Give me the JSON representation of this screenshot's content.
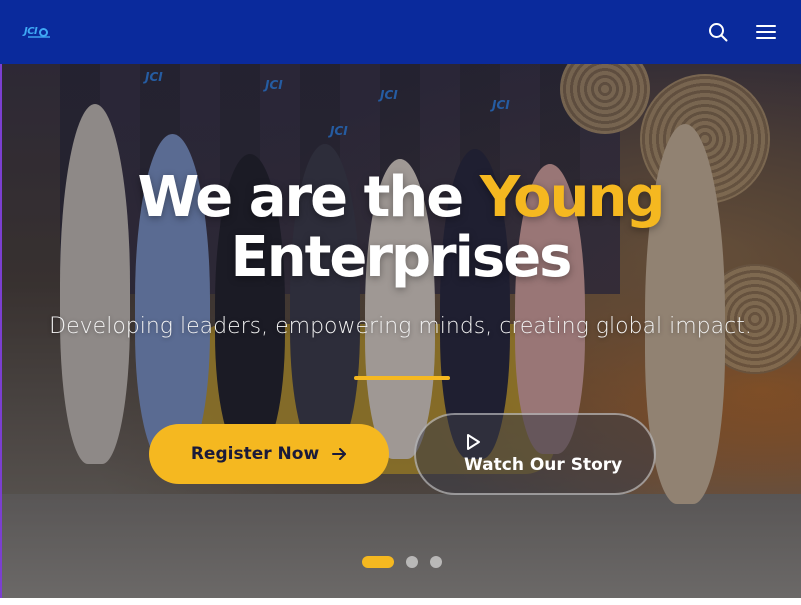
{
  "navbar": {
    "logo_text": "JCI",
    "brand_color": "#0a2a9c",
    "icons": [
      "search-icon",
      "menu-icon"
    ]
  },
  "hero": {
    "headline_part1": "We are the ",
    "headline_accent": "Young",
    "headline_part2": "Enterprises",
    "subtitle": "Developing leaders, empowering minds, creating global impact.",
    "accent_color": "#f5b820",
    "primary_button": {
      "label": "Register Now",
      "icon": "arrow-right-icon"
    },
    "secondary_button": {
      "label": "Watch Our Story",
      "icon": "play-icon"
    },
    "slides": {
      "count": 3,
      "active_index": 0
    }
  }
}
